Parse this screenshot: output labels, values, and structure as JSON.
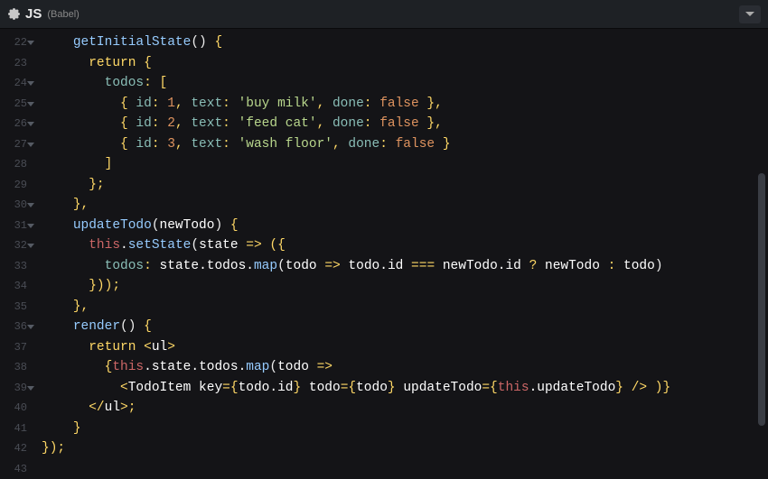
{
  "header": {
    "lang": "JS",
    "preproc": "(Babel)"
  },
  "gutter": {
    "start": 22,
    "end": 43,
    "foldable": [
      22,
      24,
      25,
      26,
      27,
      30,
      31,
      32,
      36,
      39
    ]
  },
  "code_lines": {
    "22": "    getInitialState() {",
    "23": "      return {",
    "24": "        todos: [",
    "25": "          { id: 1, text: 'buy milk', done: false },",
    "26": "          { id: 2, text: 'feed cat', done: false },",
    "27": "          { id: 3, text: 'wash floor', done: false }",
    "28": "        ]",
    "29": "      };",
    "30": "    },",
    "31": "    updateTodo(newTodo) {",
    "32": "      this.setState(state => ({",
    "33": "        todos: state.todos.map(todo => todo.id === newTodo.id ? newTodo : todo)",
    "34": "      }));",
    "35": "    },",
    "36": "    render() {",
    "37": "      return <ul>",
    "38": "        {this.state.todos.map(todo =>",
    "39": "          <TodoItem key={todo.id} todo={todo} updateTodo={this.updateTodo} /> )}",
    "40": "      </ul>;",
    "41": "    }",
    "42": "});",
    "43": ""
  },
  "tokens": {
    "22": [
      [
        "    ",
        "c-default"
      ],
      [
        "getInitialState",
        "c-fn"
      ],
      [
        "()",
        "c-paren"
      ],
      [
        " {",
        "c-keyword"
      ]
    ],
    "23": [
      [
        "      ",
        "c-default"
      ],
      [
        "return",
        "c-keyword"
      ],
      [
        " {",
        "c-keyword"
      ]
    ],
    "24": [
      [
        "        ",
        "c-default"
      ],
      [
        "todos",
        "c-prop"
      ],
      [
        ":",
        "c-keyword"
      ],
      [
        " [",
        "c-keyword"
      ]
    ],
    "25": [
      [
        "          ",
        "c-default"
      ],
      [
        "{ ",
        "c-keyword"
      ],
      [
        "id",
        "c-prop"
      ],
      [
        ":",
        "c-keyword"
      ],
      [
        " ",
        "c-default"
      ],
      [
        "1",
        "c-num"
      ],
      [
        ", ",
        "c-keyword"
      ],
      [
        "text",
        "c-prop"
      ],
      [
        ":",
        "c-keyword"
      ],
      [
        " ",
        "c-default"
      ],
      [
        "'buy milk'",
        "c-str"
      ],
      [
        ", ",
        "c-keyword"
      ],
      [
        "done",
        "c-prop"
      ],
      [
        ":",
        "c-keyword"
      ],
      [
        " ",
        "c-default"
      ],
      [
        "false",
        "c-bool"
      ],
      [
        " },",
        "c-keyword"
      ]
    ],
    "26": [
      [
        "          ",
        "c-default"
      ],
      [
        "{ ",
        "c-keyword"
      ],
      [
        "id",
        "c-prop"
      ],
      [
        ":",
        "c-keyword"
      ],
      [
        " ",
        "c-default"
      ],
      [
        "2",
        "c-num"
      ],
      [
        ", ",
        "c-keyword"
      ],
      [
        "text",
        "c-prop"
      ],
      [
        ":",
        "c-keyword"
      ],
      [
        " ",
        "c-default"
      ],
      [
        "'feed cat'",
        "c-str"
      ],
      [
        ", ",
        "c-keyword"
      ],
      [
        "done",
        "c-prop"
      ],
      [
        ":",
        "c-keyword"
      ],
      [
        " ",
        "c-default"
      ],
      [
        "false",
        "c-bool"
      ],
      [
        " },",
        "c-keyword"
      ]
    ],
    "27": [
      [
        "          ",
        "c-default"
      ],
      [
        "{ ",
        "c-keyword"
      ],
      [
        "id",
        "c-prop"
      ],
      [
        ":",
        "c-keyword"
      ],
      [
        " ",
        "c-default"
      ],
      [
        "3",
        "c-num"
      ],
      [
        ", ",
        "c-keyword"
      ],
      [
        "text",
        "c-prop"
      ],
      [
        ":",
        "c-keyword"
      ],
      [
        " ",
        "c-default"
      ],
      [
        "'wash floor'",
        "c-str"
      ],
      [
        ", ",
        "c-keyword"
      ],
      [
        "done",
        "c-prop"
      ],
      [
        ":",
        "c-keyword"
      ],
      [
        " ",
        "c-default"
      ],
      [
        "false",
        "c-bool"
      ],
      [
        " }",
        "c-keyword"
      ]
    ],
    "28": [
      [
        "        ",
        "c-default"
      ],
      [
        "]",
        "c-keyword"
      ]
    ],
    "29": [
      [
        "      ",
        "c-default"
      ],
      [
        "};",
        "c-keyword"
      ]
    ],
    "30": [
      [
        "    ",
        "c-default"
      ],
      [
        "},",
        "c-keyword"
      ]
    ],
    "31": [
      [
        "    ",
        "c-default"
      ],
      [
        "updateTodo",
        "c-fn"
      ],
      [
        "(",
        "c-paren"
      ],
      [
        "newTodo",
        "c-default"
      ],
      [
        ")",
        "c-paren"
      ],
      [
        " {",
        "c-keyword"
      ]
    ],
    "32": [
      [
        "      ",
        "c-default"
      ],
      [
        "this",
        "c-this"
      ],
      [
        ".",
        "c-default"
      ],
      [
        "setState",
        "c-fn"
      ],
      [
        "(",
        "c-paren"
      ],
      [
        "state",
        "c-default"
      ],
      [
        " ",
        "c-default"
      ],
      [
        "=>",
        "c-arrow"
      ],
      [
        " ",
        "c-default"
      ],
      [
        "({",
        "c-keyword"
      ]
    ],
    "33": [
      [
        "        ",
        "c-default"
      ],
      [
        "todos",
        "c-prop"
      ],
      [
        ":",
        "c-keyword"
      ],
      [
        " state",
        "c-default"
      ],
      [
        ".",
        "c-default"
      ],
      [
        "todos",
        "c-default"
      ],
      [
        ".",
        "c-default"
      ],
      [
        "map",
        "c-fn"
      ],
      [
        "(",
        "c-paren"
      ],
      [
        "todo",
        "c-default"
      ],
      [
        " ",
        "c-default"
      ],
      [
        "=>",
        "c-arrow"
      ],
      [
        " ",
        "c-default"
      ],
      [
        "todo",
        "c-default"
      ],
      [
        ".",
        "c-default"
      ],
      [
        "id",
        "c-default"
      ],
      [
        " ",
        "c-default"
      ],
      [
        "===",
        "c-op"
      ],
      [
        " ",
        "c-default"
      ],
      [
        "newTodo",
        "c-default"
      ],
      [
        ".",
        "c-default"
      ],
      [
        "id",
        "c-default"
      ],
      [
        " ",
        "c-default"
      ],
      [
        "?",
        "c-op"
      ],
      [
        " ",
        "c-default"
      ],
      [
        "newTodo",
        "c-default"
      ],
      [
        " ",
        "c-default"
      ],
      [
        ":",
        "c-op"
      ],
      [
        " ",
        "c-default"
      ],
      [
        "todo",
        "c-default"
      ],
      [
        ")",
        "c-paren"
      ]
    ],
    "34": [
      [
        "      ",
        "c-default"
      ],
      [
        "}));",
        "c-keyword"
      ]
    ],
    "35": [
      [
        "    ",
        "c-default"
      ],
      [
        "},",
        "c-keyword"
      ]
    ],
    "36": [
      [
        "    ",
        "c-default"
      ],
      [
        "render",
        "c-fn"
      ],
      [
        "()",
        "c-paren"
      ],
      [
        " {",
        "c-keyword"
      ]
    ],
    "37": [
      [
        "      ",
        "c-default"
      ],
      [
        "return",
        "c-keyword"
      ],
      [
        " ",
        "c-default"
      ],
      [
        "<",
        "c-op"
      ],
      [
        "ul",
        "c-tag"
      ],
      [
        ">",
        "c-op"
      ]
    ],
    "38": [
      [
        "        ",
        "c-default"
      ],
      [
        "{",
        "c-keyword"
      ],
      [
        "this",
        "c-this"
      ],
      [
        ".",
        "c-default"
      ],
      [
        "state",
        "c-default"
      ],
      [
        ".",
        "c-default"
      ],
      [
        "todos",
        "c-default"
      ],
      [
        ".",
        "c-default"
      ],
      [
        "map",
        "c-fn"
      ],
      [
        "(",
        "c-paren"
      ],
      [
        "todo",
        "c-default"
      ],
      [
        " ",
        "c-default"
      ],
      [
        "=>",
        "c-arrow"
      ]
    ],
    "39": [
      [
        "          ",
        "c-default"
      ],
      [
        "<",
        "c-op"
      ],
      [
        "TodoItem",
        "c-tag"
      ],
      [
        " ",
        "c-default"
      ],
      [
        "key",
        "c-attr"
      ],
      [
        "=",
        "c-op"
      ],
      [
        "{",
        "c-keyword"
      ],
      [
        "todo",
        "c-default"
      ],
      [
        ".",
        "c-default"
      ],
      [
        "id",
        "c-default"
      ],
      [
        "}",
        "c-keyword"
      ],
      [
        " ",
        "c-default"
      ],
      [
        "todo",
        "c-attr"
      ],
      [
        "=",
        "c-op"
      ],
      [
        "{",
        "c-keyword"
      ],
      [
        "todo",
        "c-default"
      ],
      [
        "}",
        "c-keyword"
      ],
      [
        " ",
        "c-default"
      ],
      [
        "updateTodo",
        "c-attr"
      ],
      [
        "=",
        "c-op"
      ],
      [
        "{",
        "c-keyword"
      ],
      [
        "this",
        "c-this"
      ],
      [
        ".",
        "c-default"
      ],
      [
        "updateTodo",
        "c-default"
      ],
      [
        "}",
        "c-keyword"
      ],
      [
        " ",
        "c-default"
      ],
      [
        "/>",
        "c-op"
      ],
      [
        " ",
        "c-default"
      ],
      [
        ")}",
        "c-keyword"
      ]
    ],
    "40": [
      [
        "      ",
        "c-default"
      ],
      [
        "</",
        "c-op"
      ],
      [
        "ul",
        "c-tag"
      ],
      [
        ">;",
        "c-op"
      ]
    ],
    "41": [
      [
        "    ",
        "c-default"
      ],
      [
        "}",
        "c-keyword"
      ]
    ],
    "42": [
      [
        "});",
        "c-keyword"
      ]
    ],
    "43": [
      [
        "",
        "c-default"
      ]
    ]
  }
}
